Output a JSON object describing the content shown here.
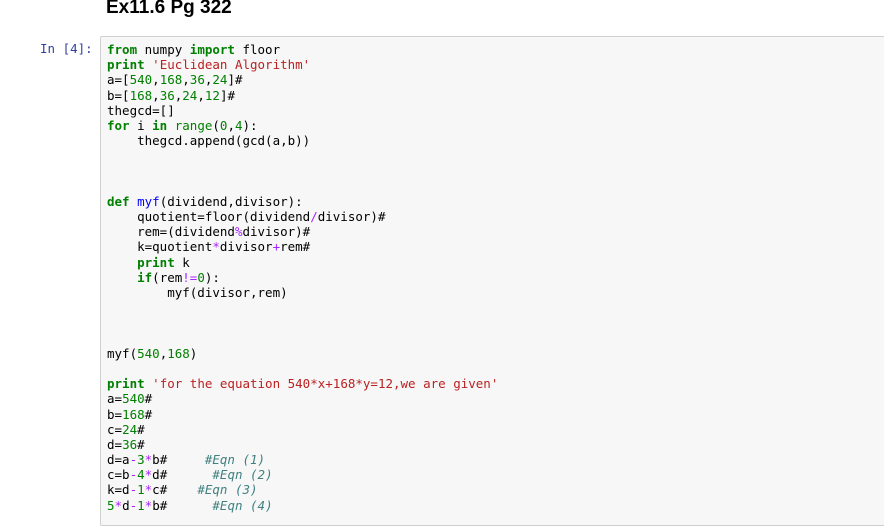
{
  "heading": "Ex11.6 Pg 322",
  "cell": {
    "prompt": "In [4]:",
    "lines": [
      [
        [
          "kw",
          "from"
        ],
        [
          "t",
          " numpy "
        ],
        [
          "kw",
          "import"
        ],
        [
          "t",
          " floor"
        ]
      ],
      [
        [
          "kw",
          "print"
        ],
        [
          "t",
          " "
        ],
        [
          "st",
          "'Euclidean Algorithm'"
        ]
      ],
      [
        [
          "t",
          "a=["
        ],
        [
          "nu",
          "540"
        ],
        [
          "t",
          ","
        ],
        [
          "nu",
          "168"
        ],
        [
          "t",
          ","
        ],
        [
          "nu",
          "36"
        ],
        [
          "t",
          ","
        ],
        [
          "nu",
          "24"
        ],
        [
          "t",
          "]#"
        ]
      ],
      [
        [
          "t",
          "b=["
        ],
        [
          "nu",
          "168"
        ],
        [
          "t",
          ","
        ],
        [
          "nu",
          "36"
        ],
        [
          "t",
          ","
        ],
        [
          "nu",
          "24"
        ],
        [
          "t",
          ","
        ],
        [
          "nu",
          "12"
        ],
        [
          "t",
          "]#"
        ]
      ],
      [
        [
          "t",
          "thegcd=[]"
        ]
      ],
      [
        [
          "kw",
          "for"
        ],
        [
          "t",
          " i "
        ],
        [
          "kw",
          "in"
        ],
        [
          "t",
          " "
        ],
        [
          "bi",
          "range"
        ],
        [
          "t",
          "("
        ],
        [
          "nu",
          "0"
        ],
        [
          "t",
          ","
        ],
        [
          "nu",
          "4"
        ],
        [
          "t",
          "):"
        ]
      ],
      [
        [
          "t",
          "    thegcd.append(gcd(a,b))"
        ]
      ],
      [],
      [],
      [],
      [
        [
          "kw",
          "def"
        ],
        [
          "t",
          " "
        ],
        [
          "fn",
          "myf"
        ],
        [
          "t",
          "(dividend,divisor):"
        ]
      ],
      [
        [
          "t",
          "    quotient=floor(dividend"
        ],
        [
          "op",
          "/"
        ],
        [
          "t",
          "divisor)#"
        ]
      ],
      [
        [
          "t",
          "    rem=(dividend"
        ],
        [
          "op",
          "%"
        ],
        [
          "t",
          "divisor)#"
        ]
      ],
      [
        [
          "t",
          "    k=quotient"
        ],
        [
          "op",
          "*"
        ],
        [
          "t",
          "divisor"
        ],
        [
          "op",
          "+"
        ],
        [
          "t",
          "rem#"
        ]
      ],
      [
        [
          "t",
          "    "
        ],
        [
          "kw",
          "print"
        ],
        [
          "t",
          " k"
        ]
      ],
      [
        [
          "t",
          "    "
        ],
        [
          "kw",
          "if"
        ],
        [
          "t",
          "(rem"
        ],
        [
          "op",
          "!="
        ],
        [
          "nu",
          "0"
        ],
        [
          "t",
          "):"
        ]
      ],
      [
        [
          "t",
          "        myf(divisor,rem)"
        ]
      ],
      [],
      [],
      [],
      [
        [
          "t",
          "myf("
        ],
        [
          "nu",
          "540"
        ],
        [
          "t",
          ","
        ],
        [
          "nu",
          "168"
        ],
        [
          "t",
          ")"
        ]
      ],
      [],
      [
        [
          "kw",
          "print"
        ],
        [
          "t",
          " "
        ],
        [
          "st",
          "'for the equation 540*x+168*y=12,we are given'"
        ]
      ],
      [
        [
          "t",
          "a="
        ],
        [
          "nu",
          "540"
        ],
        [
          "t",
          "#"
        ]
      ],
      [
        [
          "t",
          "b="
        ],
        [
          "nu",
          "168"
        ],
        [
          "t",
          "#"
        ]
      ],
      [
        [
          "t",
          "c="
        ],
        [
          "nu",
          "24"
        ],
        [
          "t",
          "#"
        ]
      ],
      [
        [
          "t",
          "d="
        ],
        [
          "nu",
          "36"
        ],
        [
          "t",
          "#"
        ]
      ],
      [
        [
          "t",
          "d=a"
        ],
        [
          "op",
          "-"
        ],
        [
          "nu",
          "3"
        ],
        [
          "op",
          "*"
        ],
        [
          "t",
          "b#     "
        ],
        [
          "cm",
          "#Eqn (1)"
        ]
      ],
      [
        [
          "t",
          "c=b"
        ],
        [
          "op",
          "-"
        ],
        [
          "nu",
          "4"
        ],
        [
          "op",
          "*"
        ],
        [
          "t",
          "d#      "
        ],
        [
          "cm",
          "#Eqn (2)"
        ]
      ],
      [
        [
          "t",
          "k=d"
        ],
        [
          "op",
          "-"
        ],
        [
          "nu",
          "1"
        ],
        [
          "op",
          "*"
        ],
        [
          "t",
          "c#    "
        ],
        [
          "cm",
          "#Eqn (3)"
        ]
      ],
      [
        [
          "nu",
          "5"
        ],
        [
          "op",
          "*"
        ],
        [
          "t",
          "d"
        ],
        [
          "op",
          "-"
        ],
        [
          "nu",
          "1"
        ],
        [
          "op",
          "*"
        ],
        [
          "t",
          "b#      "
        ],
        [
          "cm",
          "#Eqn (4)"
        ]
      ]
    ]
  }
}
